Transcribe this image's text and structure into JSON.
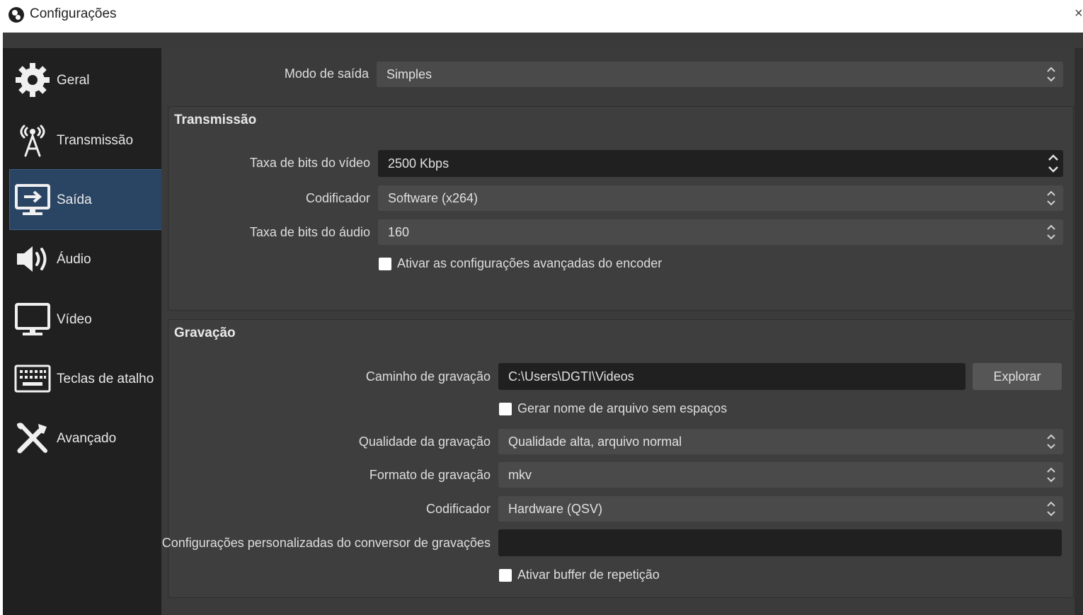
{
  "window": {
    "title": "Configurações",
    "close_glyph": "×"
  },
  "sidebar": {
    "items": [
      {
        "label": "Geral",
        "icon": "gear-icon",
        "active": false
      },
      {
        "label": "Transmissão",
        "icon": "antenna-icon",
        "active": false
      },
      {
        "label": "Saída",
        "icon": "output-icon",
        "active": true
      },
      {
        "label": "Áudio",
        "icon": "speaker-icon",
        "active": false
      },
      {
        "label": "Vídeo",
        "icon": "monitor-icon",
        "active": false
      },
      {
        "label": "Teclas de atalho",
        "icon": "keyboard-icon",
        "active": false
      },
      {
        "label": "Avançado",
        "icon": "tools-icon",
        "active": false
      }
    ]
  },
  "output_mode": {
    "label": "Modo de saída",
    "value": "Simples"
  },
  "streaming": {
    "title": "Transmissão",
    "video_bitrate": {
      "label": "Taxa de bits do vídeo",
      "value": "2500 Kbps"
    },
    "encoder": {
      "label": "Codificador",
      "value": "Software (x264)"
    },
    "audio_bitrate": {
      "label": "Taxa de bits do áudio",
      "value": "160"
    },
    "advanced_encoder": {
      "label": "Ativar as configurações avançadas do encoder",
      "checked": false
    }
  },
  "recording": {
    "title": "Gravação",
    "path": {
      "label": "Caminho de gravação",
      "value": "C:\\Users\\DGTI\\Videos",
      "browse_label": "Explorar"
    },
    "no_spaces": {
      "label": "Gerar nome de arquivo sem espaços",
      "checked": false
    },
    "quality": {
      "label": "Qualidade da gravação",
      "value": "Qualidade alta, arquivo normal"
    },
    "format": {
      "label": "Formato de gravação",
      "value": "mkv"
    },
    "encoder": {
      "label": "Codificador",
      "value": "Hardware (QSV)"
    },
    "muxer": {
      "label": "Configurações personalizadas do conversor de gravações",
      "value": ""
    },
    "replay_buffer": {
      "label": "Ativar buffer de repetição",
      "checked": false
    }
  },
  "colors": {
    "accent": "#2a4564",
    "background": "#3b3b3b",
    "sidebar": "#202020",
    "input": "#4a4a4a"
  }
}
